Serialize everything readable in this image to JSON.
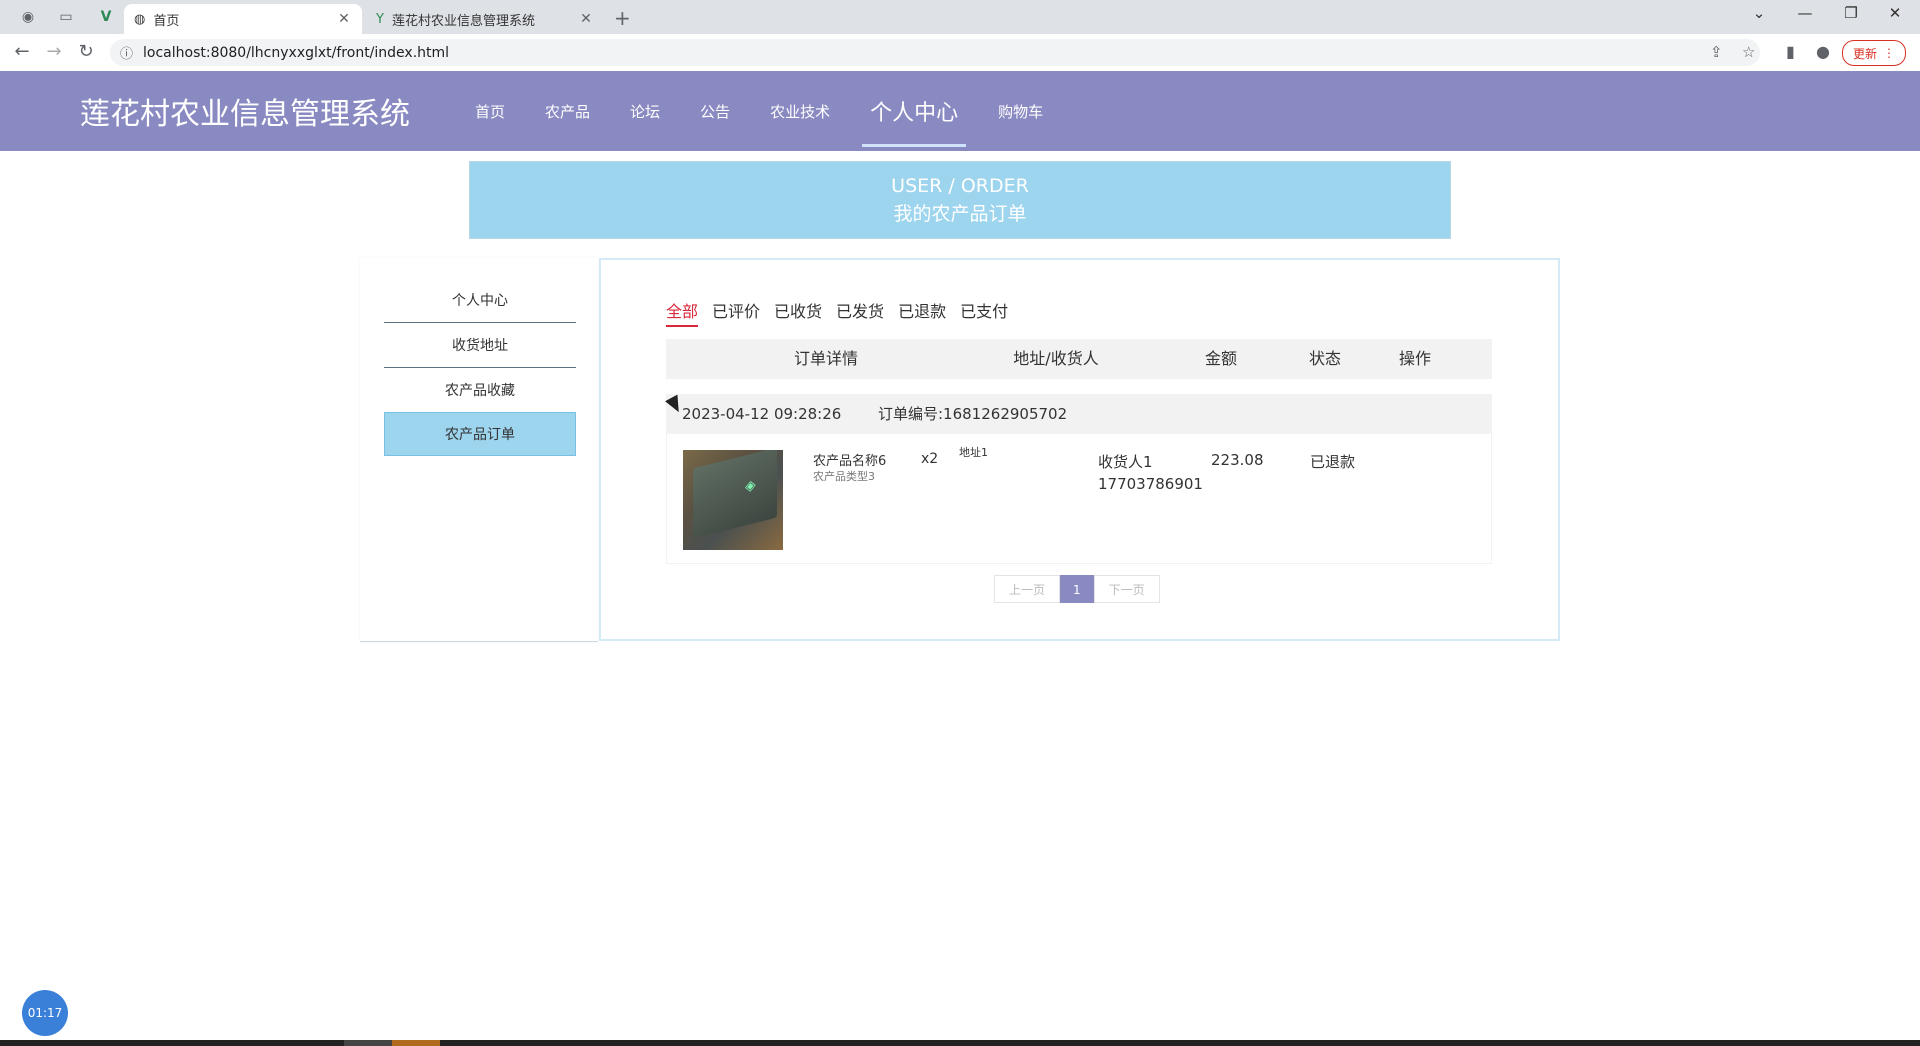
{
  "browser": {
    "tabs": [
      {
        "title": "首页",
        "active": true
      },
      {
        "title": "莲花村农业信息管理系统",
        "active": false
      }
    ],
    "url": "localhost:8080/lhcnyxxglxt/front/index.html",
    "update_label": "更新"
  },
  "site": {
    "title": "莲花村农业信息管理系统",
    "nav": [
      "首页",
      "农产品",
      "论坛",
      "公告",
      "农业技术",
      "个人中心",
      "购物车"
    ],
    "active_nav": "个人中心"
  },
  "banner": {
    "line1": "USER / ORDER",
    "line2": "我的农产品订单"
  },
  "sidebar": {
    "items": [
      "个人中心",
      "收货地址",
      "农产品收藏",
      "农产品订单"
    ],
    "active": "农产品订单"
  },
  "filters": {
    "items": [
      "全部",
      "已评价",
      "已收货",
      "已发货",
      "已退款",
      "已支付"
    ],
    "active": "全部"
  },
  "table": {
    "headers": [
      "订单详情",
      "地址/收货人",
      "金额",
      "状态",
      "操作"
    ]
  },
  "order": {
    "time": "2023-04-12 09:28:26",
    "number_label": "订单编号:1681262905702",
    "product_name": "农产品名称6",
    "product_type": "农产品类型3",
    "quantity": "x2",
    "address": "地址1",
    "receiver": "收货人1",
    "phone": "17703786901",
    "amount": "223.08",
    "status": "已退款"
  },
  "pagination": {
    "prev": "上一页",
    "current": "1",
    "next": "下一页"
  },
  "timer": "01:17",
  "colors": {
    "header_bg": "#8a8ac3",
    "banner_bg": "#9dd4ee",
    "filter_active": "#d9283a"
  }
}
